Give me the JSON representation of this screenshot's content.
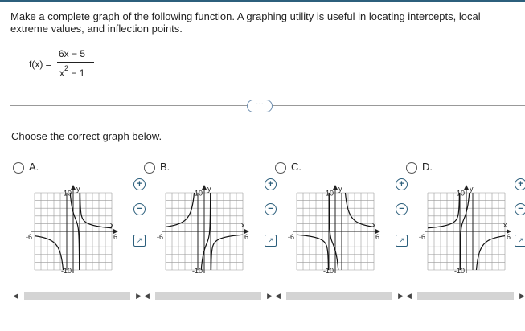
{
  "question": {
    "text": "Make a complete graph of the following function. A graphing utility is useful in locating intercepts, local extreme values, and inflection points."
  },
  "function": {
    "lhs": "f(x) =",
    "numerator": "6x − 5",
    "denominator_base": "x",
    "denominator_exp": "2",
    "denominator_rest": "− 1"
  },
  "more_button": "···",
  "instruction": "Choose the correct graph below.",
  "options": [
    {
      "letter": "A.",
      "selected": false
    },
    {
      "letter": "B.",
      "selected": false
    },
    {
      "letter": "C.",
      "selected": false
    },
    {
      "letter": "D.",
      "selected": false
    }
  ],
  "graph_labels": {
    "y_axis": "y",
    "x_axis": "x",
    "y_max": "10",
    "y_min": "-10",
    "x_min": "-6",
    "x_max": "6"
  },
  "graph_window": {
    "xlim": [
      -6,
      6
    ],
    "ylim": [
      -10,
      10
    ],
    "asymptotes_x": [
      -1,
      1
    ]
  },
  "tools": {
    "zoom_in_icon": "zoom-in-icon",
    "zoom_out_icon": "zoom-out-icon",
    "popout_icon": "external-link-icon"
  }
}
